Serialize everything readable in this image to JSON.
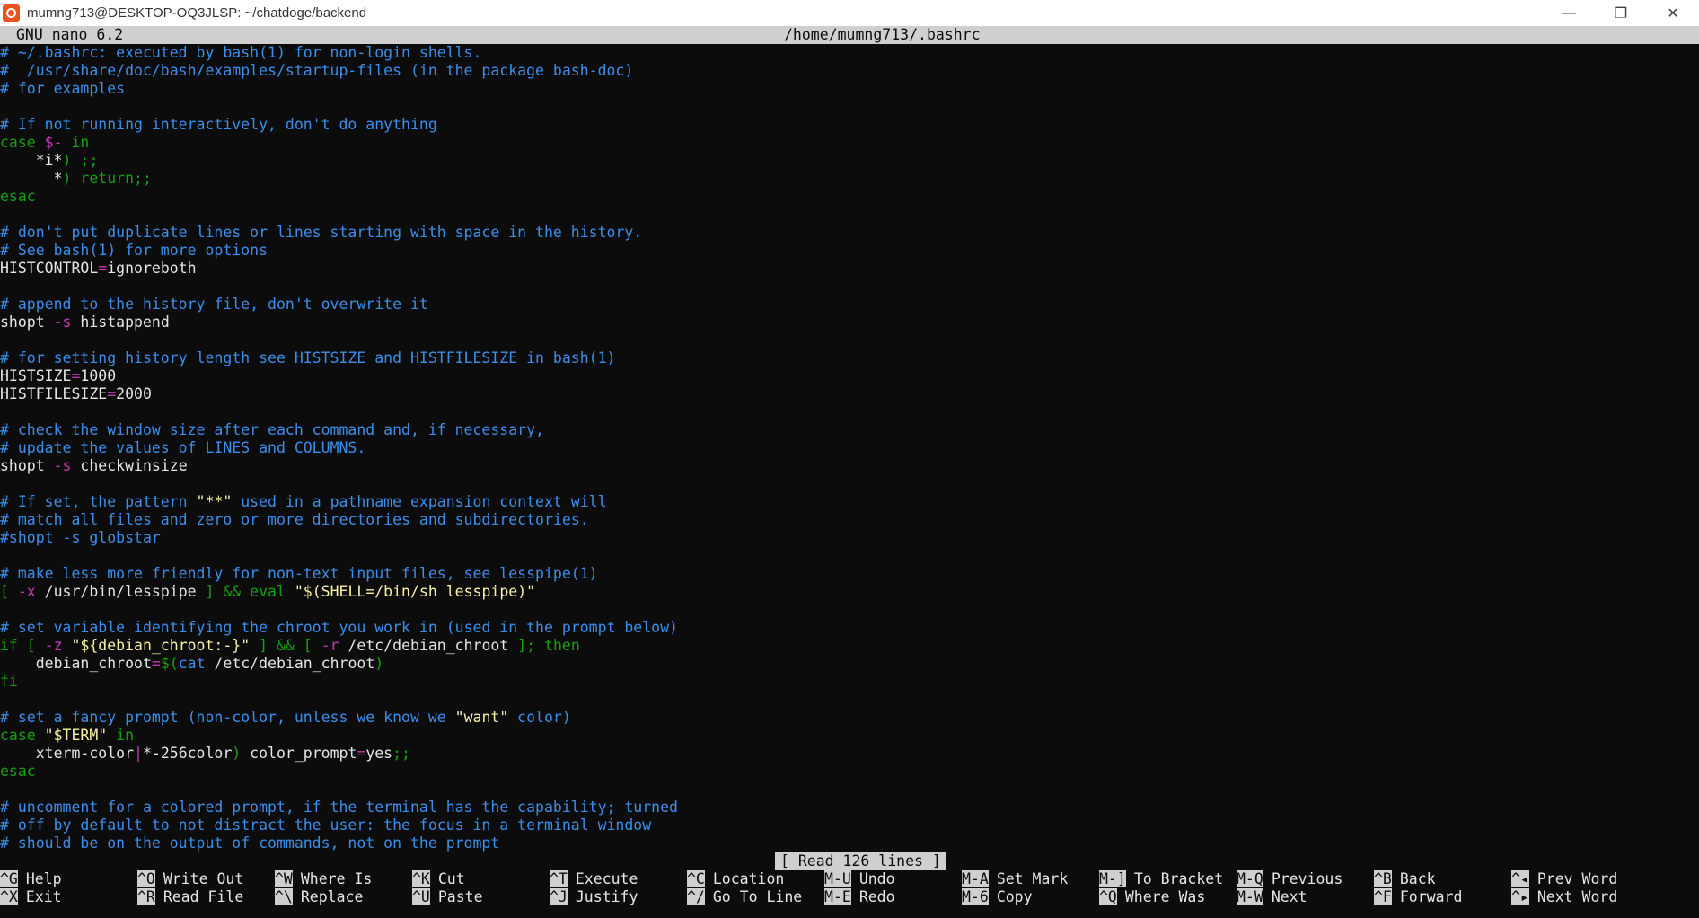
{
  "window": {
    "title": "mumng713@DESKTOP-OQ3JLSP: ~/chatdoge/backend",
    "controls": [
      "—",
      "❐",
      "✕"
    ]
  },
  "nano": {
    "version": "GNU nano 6.2",
    "filename": "/home/mumng713/.bashrc",
    "status": "[ Read 126 lines ]"
  },
  "lines": [
    [
      [
        "cm",
        "# ~/.bashrc: executed by bash(1) for non-login shells."
      ]
    ],
    [
      [
        "cm",
        "#  /usr/share/doc/bash/examples/startup-files (in the package bash-doc)"
      ]
    ],
    [
      [
        "cm",
        "# for examples"
      ]
    ],
    [],
    [
      [
        "cm",
        "# If not running interactively, don't do anything"
      ]
    ],
    [
      [
        "kw",
        "case "
      ],
      [
        "vr",
        "$-"
      ],
      [
        "kw",
        " in"
      ]
    ],
    [
      [
        "pl",
        "    *i*"
      ],
      [
        "kw",
        ") ;;"
      ]
    ],
    [
      [
        "pl",
        "      *"
      ],
      [
        "kw",
        ") return;;"
      ]
    ],
    [
      [
        "kw",
        "esac"
      ]
    ],
    [],
    [
      [
        "cm",
        "# don't put duplicate lines or lines starting with space in the history."
      ]
    ],
    [
      [
        "cm",
        "# See bash(1) for more options"
      ]
    ],
    [
      [
        "pl",
        "HISTCONTROL"
      ],
      [
        "op",
        "="
      ],
      [
        "pl",
        "ignoreboth"
      ]
    ],
    [],
    [
      [
        "cm",
        "# append to the history file, don't overwrite it"
      ]
    ],
    [
      [
        "pl",
        "shopt "
      ],
      [
        "op",
        "-s"
      ],
      [
        "pl",
        " histappend"
      ]
    ],
    [],
    [
      [
        "cm",
        "# for setting history length see HISTSIZE and HISTFILESIZE in bash(1)"
      ]
    ],
    [
      [
        "pl",
        "HISTSIZE"
      ],
      [
        "op",
        "="
      ],
      [
        "pl",
        "1000"
      ]
    ],
    [
      [
        "pl",
        "HISTFILESIZE"
      ],
      [
        "op",
        "="
      ],
      [
        "pl",
        "2000"
      ]
    ],
    [],
    [
      [
        "cm",
        "# check the window size after each command and, if necessary,"
      ]
    ],
    [
      [
        "cm",
        "# update the values of LINES and COLUMNS."
      ]
    ],
    [
      [
        "pl",
        "shopt "
      ],
      [
        "op",
        "-s"
      ],
      [
        "pl",
        " checkwinsize"
      ]
    ],
    [],
    [
      [
        "cm",
        "# If set, the pattern "
      ],
      [
        "str",
        "\"**\""
      ],
      [
        "cm",
        " used in a pathname expansion context will"
      ]
    ],
    [
      [
        "cm",
        "# match all files and zero or more directories and subdirectories."
      ]
    ],
    [
      [
        "cm",
        "#shopt -s globstar"
      ]
    ],
    [],
    [
      [
        "cm",
        "# make less more friendly for non-text input files, see lesspipe(1)"
      ]
    ],
    [
      [
        "kw",
        "[ "
      ],
      [
        "op",
        "-x"
      ],
      [
        "pl",
        " /usr/bin/lesspipe "
      ],
      [
        "kw",
        "] && eval "
      ],
      [
        "str",
        "\"$(SHELL=/bin/sh lesspipe)\""
      ]
    ],
    [],
    [
      [
        "cm",
        "# set variable identifying the chroot you work in (used in the prompt below)"
      ]
    ],
    [
      [
        "kw",
        "if [ "
      ],
      [
        "op",
        "-z"
      ],
      [
        "pl",
        " "
      ],
      [
        "str",
        "\"${debian_chroot:-}\""
      ],
      [
        "kw",
        " ] && [ "
      ],
      [
        "op",
        "-r"
      ],
      [
        "pl",
        " /etc/debian_chroot "
      ],
      [
        "kw",
        "]; then"
      ]
    ],
    [
      [
        "pl",
        "    debian_chroot"
      ],
      [
        "op",
        "="
      ],
      [
        "kw",
        "$("
      ],
      [
        "cm",
        "cat"
      ],
      [
        "pl",
        " /etc/debian_chroot"
      ],
      [
        "kw",
        ")"
      ]
    ],
    [
      [
        "kw",
        "fi"
      ]
    ],
    [],
    [
      [
        "cm",
        "# set a fancy prompt (non-color, unless we know we "
      ],
      [
        "str",
        "\"want\""
      ],
      [
        "cm",
        " color)"
      ]
    ],
    [
      [
        "kw",
        "case "
      ],
      [
        "str",
        "\"$TERM\""
      ],
      [
        "kw",
        " in"
      ]
    ],
    [
      [
        "pl",
        "    xterm-color"
      ],
      [
        "op",
        "|"
      ],
      [
        "pl",
        "*-256color"
      ],
      [
        "kw",
        ")"
      ],
      [
        "pl",
        " color_prompt"
      ],
      [
        "op",
        "="
      ],
      [
        "pl",
        "yes"
      ],
      [
        "kw",
        ";;"
      ]
    ],
    [
      [
        "kw",
        "esac"
      ]
    ],
    [],
    [
      [
        "cm",
        "# uncomment for a colored prompt, if the terminal has the capability; turned"
      ]
    ],
    [
      [
        "cm",
        "# off by default to not distract the user: the focus in a terminal window"
      ]
    ],
    [
      [
        "cm",
        "# should be on the output of commands, not on the prompt"
      ]
    ]
  ],
  "shortcuts": [
    [
      {
        "key": "^G",
        "label": "Help"
      },
      {
        "key": "^O",
        "label": "Write Out"
      },
      {
        "key": "^W",
        "label": "Where Is"
      },
      {
        "key": "^K",
        "label": "Cut"
      },
      {
        "key": "^T",
        "label": "Execute"
      },
      {
        "key": "^C",
        "label": "Location"
      },
      {
        "key": "M-U",
        "label": "Undo"
      },
      {
        "key": "M-A",
        "label": "Set Mark"
      },
      {
        "key": "M-]",
        "label": "To Bracket"
      },
      {
        "key": "M-Q",
        "label": "Previous"
      },
      {
        "key": "^B",
        "label": "Back"
      },
      {
        "key": "^◂",
        "label": "Prev Word"
      }
    ],
    [
      {
        "key": "^X",
        "label": "Exit"
      },
      {
        "key": "^R",
        "label": "Read File"
      },
      {
        "key": "^\\",
        "label": "Replace"
      },
      {
        "key": "^U",
        "label": "Paste"
      },
      {
        "key": "^J",
        "label": "Justify"
      },
      {
        "key": "^/",
        "label": "Go To Line"
      },
      {
        "key": "M-E",
        "label": "Redo"
      },
      {
        "key": "M-6",
        "label": "Copy"
      },
      {
        "key": "^Q",
        "label": "Where Was"
      },
      {
        "key": "M-W",
        "label": "Next"
      },
      {
        "key": "^F",
        "label": "Forward"
      },
      {
        "key": "^▸",
        "label": "Next Word"
      }
    ]
  ]
}
